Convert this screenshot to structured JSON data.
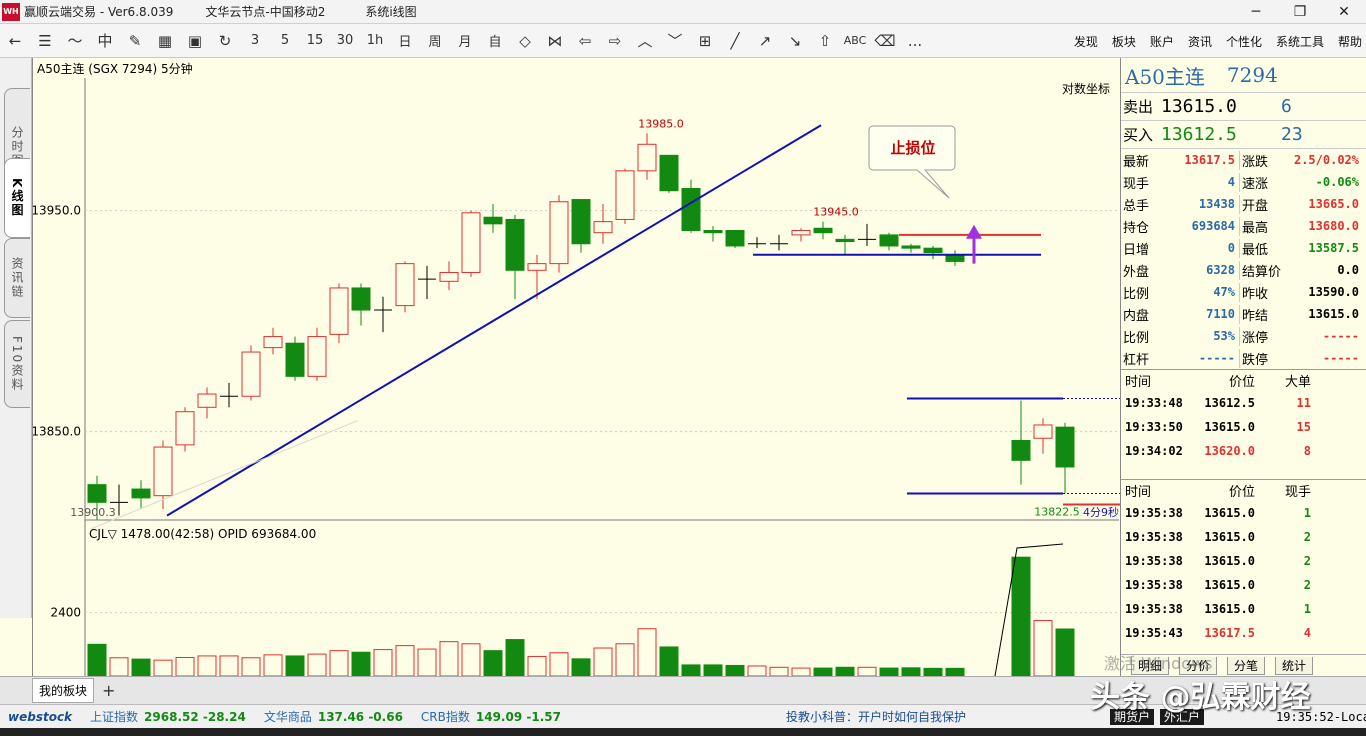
{
  "titlebar": {
    "app": "赢顺云端交易 - Ver6.8.039",
    "node": "文华云节点-中国移动2",
    "sys": "系统i线图"
  },
  "toolbar": {
    "icons": [
      "back-arrow-icon",
      "list-icon",
      "line-chart-icon",
      "candle-icon",
      "pencil-chart-icon",
      "grid-icon",
      "save-icon",
      "refresh-icon"
    ],
    "periods": [
      "3",
      "5",
      "15",
      "30",
      "1h",
      "日",
      "周",
      "月",
      "自"
    ],
    "tools_end": [
      "ABC",
      "..."
    ],
    "menus": [
      "发现",
      "板块",
      "账户",
      "资讯",
      "个性化",
      "系统工具",
      "帮助"
    ]
  },
  "left_tabs": [
    "分时图",
    "K线图",
    "资讯链",
    "F10资料"
  ],
  "chart": {
    "header": "A50主连 (SGX 7294)  5分钟",
    "log_coord": "对数坐标",
    "countdown": "4分9秒",
    "stop_label": "止损位",
    "price_labels": [
      "13950.0",
      "13850.0"
    ],
    "volume_label": "2400",
    "vol_header": "CJL▽   1478.00(42:58)     OPID 693684.00",
    "annotations": [
      "13985.0",
      "13945.0",
      "13822.5",
      "13900.3"
    ]
  },
  "chart_data": {
    "type": "candlestick",
    "symbol": "A50主连 (SGX 7294)",
    "period": "5分钟",
    "y_ticks": [
      13950.0,
      13850.0
    ],
    "ylim": [
      13810,
      14010
    ],
    "high_marker": 13985.0,
    "mid_marker": 13945.0,
    "low_marker": 13822.5,
    "candles": [
      {
        "o": 13826,
        "c": 13818,
        "h": 13830,
        "l": 13810
      },
      {
        "o": 13818,
        "c": 13818,
        "h": 13826,
        "l": 13812
      },
      {
        "o": 13824,
        "c": 13820,
        "h": 13828,
        "l": 13815
      },
      {
        "o": 13821,
        "c": 13843,
        "h": 13846,
        "l": 13815
      },
      {
        "o": 13844,
        "c": 13859,
        "h": 13861,
        "l": 13841
      },
      {
        "o": 13861,
        "c": 13867,
        "h": 13870,
        "l": 13856
      },
      {
        "o": 13866,
        "c": 13866,
        "h": 13872,
        "l": 13861
      },
      {
        "o": 13866,
        "c": 13886,
        "h": 13889,
        "l": 13864
      },
      {
        "o": 13888,
        "c": 13893,
        "h": 13897,
        "l": 13885
      },
      {
        "o": 13890,
        "c": 13875,
        "h": 13893,
        "l": 13873
      },
      {
        "o": 13875,
        "c": 13893,
        "h": 13897,
        "l": 13873
      },
      {
        "o": 13894,
        "c": 13915,
        "h": 13917,
        "l": 13890
      },
      {
        "o": 13915,
        "c": 13905,
        "h": 13917,
        "l": 13898
      },
      {
        "o": 13905,
        "c": 13905,
        "h": 13911,
        "l": 13895
      },
      {
        "o": 13907,
        "c": 13926,
        "h": 13927,
        "l": 13904
      },
      {
        "o": 13919,
        "c": 13919,
        "h": 13925,
        "l": 13910
      },
      {
        "o": 13918,
        "c": 13922,
        "h": 13927,
        "l": 13914
      },
      {
        "o": 13922,
        "c": 13949,
        "h": 13950,
        "l": 13920
      },
      {
        "o": 13947,
        "c": 13944,
        "h": 13953,
        "l": 13940
      },
      {
        "o": 13946,
        "c": 13923,
        "h": 13948,
        "l": 13910
      },
      {
        "o": 13923,
        "c": 13926,
        "h": 13930,
        "l": 13910
      },
      {
        "o": 13926,
        "c": 13954,
        "h": 13957,
        "l": 13922
      },
      {
        "o": 13955,
        "c": 13935,
        "h": 13955,
        "l": 13931
      },
      {
        "o": 13940,
        "c": 13945,
        "h": 13953,
        "l": 13935
      },
      {
        "o": 13946,
        "c": 13968,
        "h": 13969,
        "l": 13944
      },
      {
        "o": 13968,
        "c": 13980,
        "h": 13985,
        "l": 13964
      },
      {
        "o": 13975,
        "c": 13959,
        "h": 13975,
        "l": 13958
      },
      {
        "o": 13960,
        "c": 13941,
        "h": 13964,
        "l": 13940
      },
      {
        "o": 13941,
        "c": 13940,
        "h": 13943,
        "l": 13936
      },
      {
        "o": 13941,
        "c": 13934,
        "h": 13941,
        "l": 13933
      },
      {
        "o": 13935,
        "c": 13935,
        "h": 13938,
        "l": 13933
      },
      {
        "o": 13935,
        "c": 13935,
        "h": 13939,
        "l": 13932
      },
      {
        "o": 13939,
        "c": 13941,
        "h": 13942,
        "l": 13936
      },
      {
        "o": 13942,
        "c": 13940,
        "h": 13945,
        "l": 13937
      },
      {
        "o": 13937,
        "c": 13936,
        "h": 13939,
        "l": 13930
      },
      {
        "o": 13937,
        "c": 13937,
        "h": 13944,
        "l": 13934
      },
      {
        "o": 13939,
        "c": 13934,
        "h": 13940,
        "l": 13932
      },
      {
        "o": 13934,
        "c": 13933,
        "h": 13935,
        "l": 13931
      },
      {
        "o": 13933,
        "c": 13931,
        "h": 13934,
        "l": 13928
      },
      {
        "o": 13930,
        "c": 13927,
        "h": 13932,
        "l": 13925
      },
      {
        "o": 13846,
        "c": 13837,
        "h": 13864,
        "l": 13826
      },
      {
        "o": 13847,
        "c": 13853,
        "h": 13856,
        "l": 13840
      },
      {
        "o": 13852,
        "c": 13834,
        "h": 13854,
        "l": 13822
      }
    ],
    "volumes": [
      1200,
      690,
      640,
      600,
      700,
      760,
      760,
      690,
      800,
      760,
      830,
      960,
      900,
      1000,
      1150,
      1020,
      1300,
      1220,
      960,
      1380,
      740,
      880,
      650,
      1060,
      1220,
      1790,
      1100,
      420,
      420,
      400,
      380,
      330,
      300,
      300,
      330,
      330,
      300,
      310,
      290,
      290,
      4500,
      2100,
      1780
    ]
  },
  "quote": {
    "name": "A50主连",
    "code": "7294",
    "ask_label": "卖出",
    "ask_price": "13615.0",
    "ask_vol": "6",
    "bid_label": "买入",
    "bid_price": "13612.5",
    "bid_vol": "23",
    "stats": [
      [
        "最新",
        "13617.5",
        "涨跌",
        "2.5/0.02%"
      ],
      [
        "现手",
        "4",
        "速涨",
        "-0.06%"
      ],
      [
        "总手",
        "13438",
        "开盘",
        "13665.0"
      ],
      [
        "持仓",
        "693684",
        "最高",
        "13680.0"
      ],
      [
        "日增",
        "0",
        "最低",
        "13587.5"
      ],
      [
        "外盘",
        "6328",
        "结算价",
        "0.0"
      ],
      [
        "比例",
        "47%",
        "昨收",
        "13590.0"
      ],
      [
        "内盘",
        "7110",
        "昨结",
        "13615.0"
      ],
      [
        "比例",
        "53%",
        "涨停",
        "-----"
      ],
      [
        "杠杆",
        "-----",
        "跌停",
        "-----"
      ]
    ],
    "big_head": [
      "时间",
      "价位",
      "大单"
    ],
    "big_rows": [
      [
        "19:33:48",
        "13612.5",
        "11"
      ],
      [
        "19:33:50",
        "13615.0",
        "15"
      ],
      [
        "19:34:02",
        "13620.0",
        "8"
      ]
    ],
    "tick_head": [
      "时间",
      "价位",
      "现手"
    ],
    "tick_rows": [
      [
        "19:35:38",
        "13615.0",
        "1"
      ],
      [
        "19:35:38",
        "13615.0",
        "2"
      ],
      [
        "19:35:38",
        "13615.0",
        "2"
      ],
      [
        "19:35:38",
        "13615.0",
        "2"
      ],
      [
        "19:35:38",
        "13615.0",
        "1"
      ],
      [
        "19:35:43",
        "13617.5",
        "4"
      ]
    ],
    "tabs": [
      "明细",
      "分价",
      "分笔",
      "统计"
    ]
  },
  "bottom": {
    "block_tab": "我的板块",
    "brand": "webstock",
    "idx1_name": "上证指数",
    "idx1_val": "2968.52 -28.24",
    "idx2_name": "文华商品",
    "idx2_val": "137.46 -0.66",
    "idx3_name": "CRB指数",
    "idx3_val": "149.09 -1.57",
    "tip": "投教小科普：开户时如何自我保护",
    "mode1": "期货户",
    "mode2": "外汇户",
    "clock": "19:35:52-Local",
    "watermark": "头条 @弘霖财经",
    "activate": "激活 Windows"
  },
  "colors": {
    "up": "#e03030",
    "down": "#128a12",
    "trend": "#1010b8",
    "bg": "#fefee6",
    "quote_blue": "#2a6aa8",
    "arrow": "#a030e0"
  }
}
